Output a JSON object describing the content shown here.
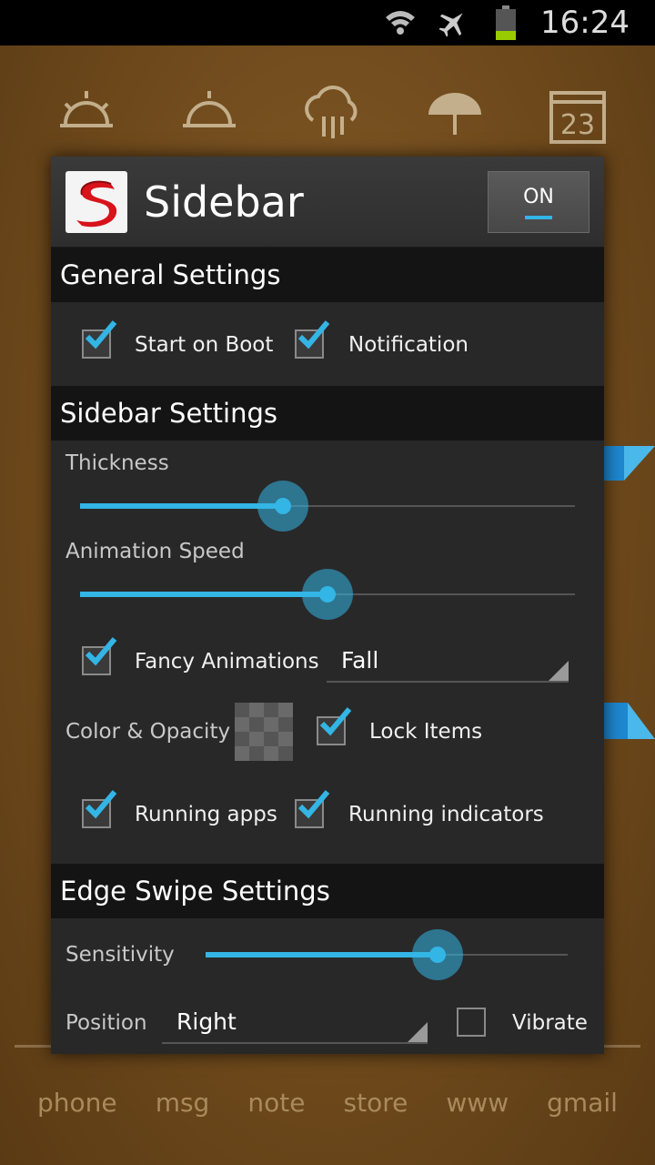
{
  "status_bar": {
    "time": "16:24"
  },
  "background": {
    "dock": [
      "phone",
      "msg",
      "note",
      "store",
      "www",
      "gmail"
    ],
    "calendar_day": "23"
  },
  "dialog": {
    "logo_letter": "S",
    "title": "Sidebar",
    "toggle": {
      "label": "ON",
      "state": true
    },
    "general": {
      "header": "General Settings",
      "start_on_boot": {
        "label": "Start on Boot",
        "checked": true
      },
      "notification": {
        "label": "Notification",
        "checked": true
      }
    },
    "sidebar": {
      "header": "Sidebar Settings",
      "thickness": {
        "label": "Thickness",
        "value_pct": 41
      },
      "animation_speed": {
        "label": "Animation Speed",
        "value_pct": 50
      },
      "fancy_animations": {
        "label": "Fancy Animations",
        "checked": true,
        "selected": "Fall"
      },
      "color_opacity": {
        "label": "Color & Opacity"
      },
      "lock_items": {
        "label": "Lock Items",
        "checked": true
      },
      "running_apps": {
        "label": "Running apps",
        "checked": true
      },
      "running_indicators": {
        "label": "Running indicators",
        "checked": true
      }
    },
    "edge_swipe": {
      "header": "Edge Swipe Settings",
      "sensitivity": {
        "label": "Sensitivity",
        "value_pct": 64
      },
      "position": {
        "label": "Position",
        "selected": "Right"
      },
      "vibrate": {
        "label": "Vibrate",
        "checked": false
      }
    }
  },
  "colors": {
    "accent": "#33b5e5",
    "logo_red": "#d8131b"
  }
}
